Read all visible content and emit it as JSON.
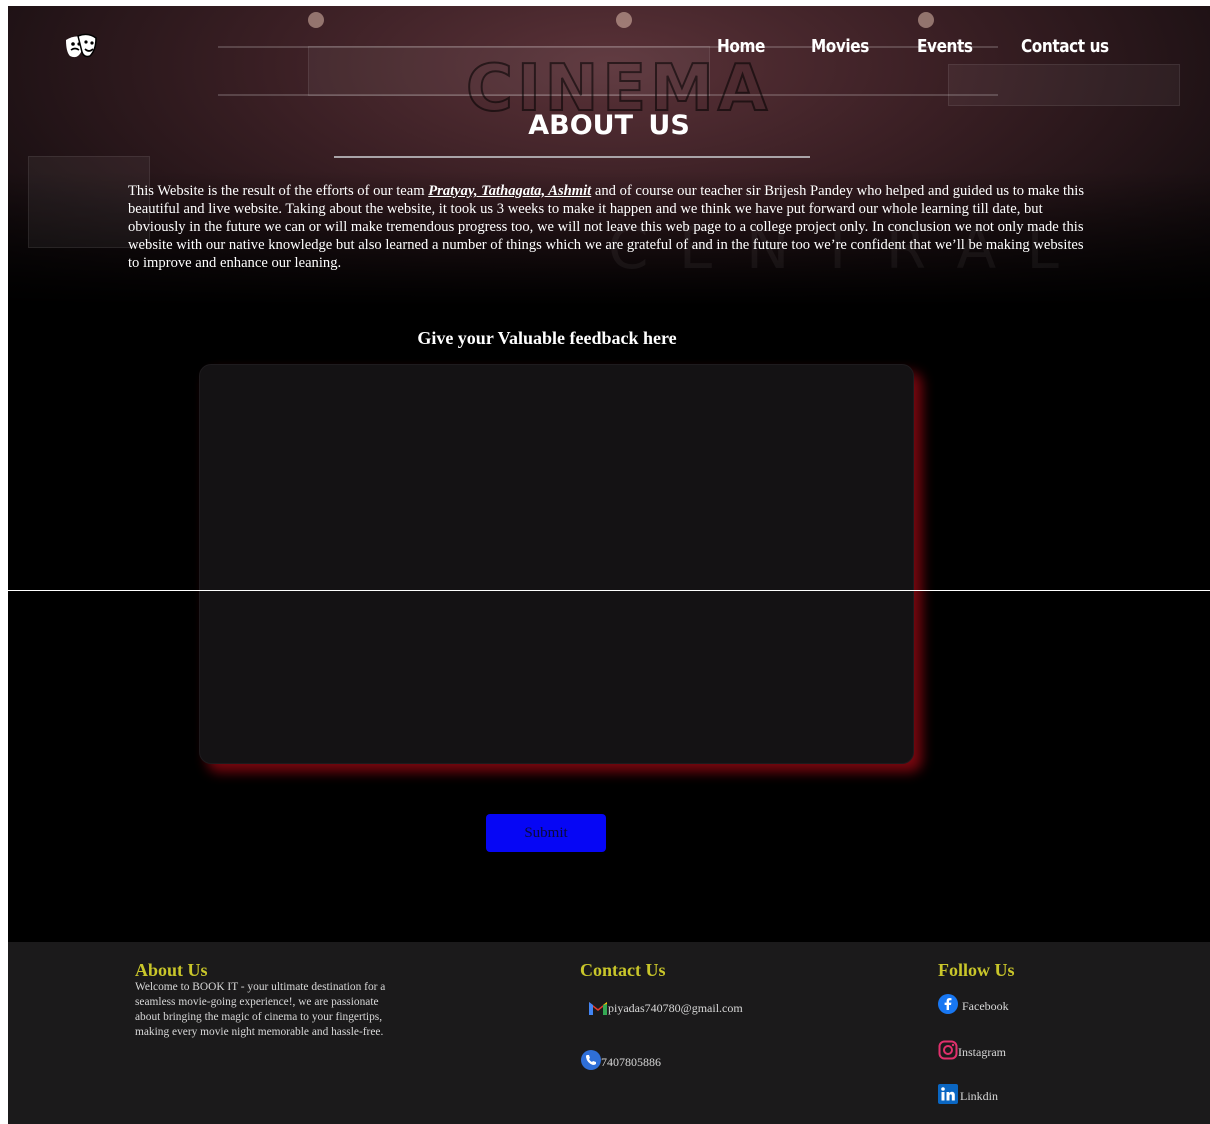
{
  "header": {
    "logo_icon": "theater-masks-icon",
    "nav": [
      "Home",
      "Movies",
      "Events",
      "Contact us"
    ]
  },
  "about": {
    "title": "ABOUT  US",
    "text_before": "This Website is the result of the efforts of our team ",
    "team": "Pratyay, Tathagata, Ashmit",
    "text_after": " and of course our teacher sir Brijesh Pandey who helped and guided us to make this beautiful and live website. Taking about the website, it took us 3 weeks to make it happen and we think we have put forward our whole learning till date, but obviously in the future we can or will make tremendous progress too, we will not leave this web page to a college project only. In conclusion we not only made this website with our native knowledge but also learned a number of things which we are grateful of and in the future too we’re confident that we’ll be making websites to improve and enhance our leaning."
  },
  "feedback": {
    "heading": "Give your Valuable feedback here",
    "value": "",
    "submit_label": "Submit"
  },
  "footer": {
    "about": {
      "heading": "About Us",
      "text": "Welcome to BOOK IT - your ultimate destination for a seamless movie-going experience!, we are passionate about bringing the magic of cinema to your fingertips, making every movie night memorable and hassle-free."
    },
    "contact": {
      "heading": "Contact Us",
      "email": "piyadas740780@gmail.com",
      "phone": "7407805886"
    },
    "follow": {
      "heading": "Follow Us",
      "links": [
        "Facebook",
        "Instagram",
        "Linkdin"
      ]
    }
  },
  "colors": {
    "background": "#000000",
    "footer_bg": "#1b1a1b",
    "footer_heading": "#c9c62a",
    "submit_bg": "#0606f5",
    "feedback_glow": "#a00a14"
  }
}
